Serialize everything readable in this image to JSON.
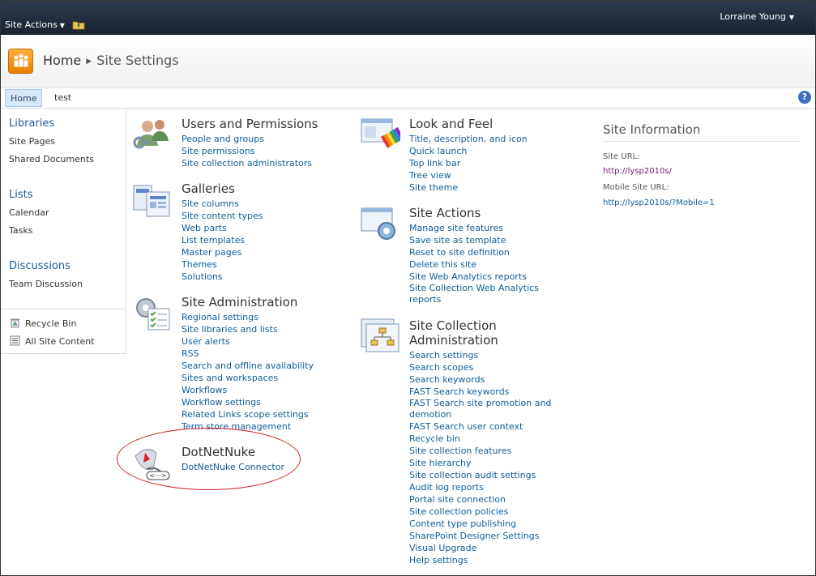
{
  "topbar": {
    "site_actions": "Site Actions",
    "user": "Lorraine Young"
  },
  "breadcrumb": {
    "home": "Home",
    "current": "Site Settings"
  },
  "topnav": {
    "home": "Home",
    "test": "test",
    "help": "?"
  },
  "leftnav": {
    "libraries": "Libraries",
    "site_pages": "Site Pages",
    "shared_documents": "Shared Documents",
    "lists": "Lists",
    "calendar": "Calendar",
    "tasks": "Tasks",
    "discussions": "Discussions",
    "team_discussion": "Team Discussion",
    "recycle_bin": "Recycle Bin",
    "all_site_content": "All Site Content"
  },
  "sections": {
    "users": {
      "title": "Users and Permissions",
      "links": [
        "People and groups",
        "Site permissions",
        "Site collection administrators"
      ]
    },
    "galleries": {
      "title": "Galleries",
      "links": [
        "Site columns",
        "Site content types",
        "Web parts",
        "List templates",
        "Master pages",
        "Themes",
        "Solutions"
      ]
    },
    "site_admin": {
      "title": "Site Administration",
      "links": [
        "Regional settings",
        "Site libraries and lists",
        "User alerts",
        "RSS",
        "Search and offline availability",
        "Sites and workspaces",
        "Workflows",
        "Workflow settings",
        "Related Links scope settings",
        "Term store management"
      ]
    },
    "dnn": {
      "title": "DotNetNuke",
      "links": [
        "DotNetNuke Connector"
      ]
    },
    "look_feel": {
      "title": "Look and Feel",
      "links": [
        "Title, description, and icon",
        "Quick launch",
        "Top link bar",
        "Tree view",
        "Site theme"
      ]
    },
    "site_actions": {
      "title": "Site Actions",
      "links": [
        "Manage site features",
        "Save site as template",
        "Reset to site definition",
        "Delete this site",
        "Site Web Analytics reports",
        "Site Collection Web Analytics",
        "reports"
      ]
    },
    "site_collection_admin": {
      "title_line1": "Site Collection",
      "title_line2": "Administration",
      "links": [
        "Search settings",
        "Search scopes",
        "Search keywords",
        "FAST Search keywords",
        "FAST Search site promotion and",
        "demotion",
        "FAST Search user context",
        "Recycle bin",
        "Site collection features",
        "Site hierarchy",
        "Site collection audit settings",
        "Audit log reports",
        "Portal site connection",
        "Site collection policies",
        "Content type publishing",
        "SharePoint Designer Settings",
        "Visual Upgrade",
        "Help settings"
      ]
    }
  },
  "site_info": {
    "header": "Site Information",
    "site_url_label": "Site URL:",
    "site_url": "http://lysp2010s/",
    "mobile_url_label": "Mobile Site URL:",
    "mobile_url": "http://lysp2010s/?Mobile=1"
  },
  "colors": {
    "link": "#0f5e9a",
    "visited_link": "#7a1d84",
    "ribbon": "#1e2835",
    "highlight": "#d01f1f"
  }
}
